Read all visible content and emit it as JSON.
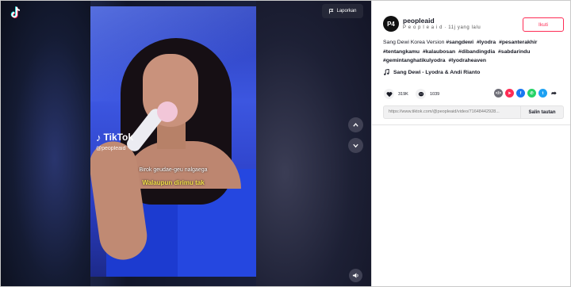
{
  "viewer": {
    "report_label": "Laporkan",
    "watermark": {
      "brand": "TikTok",
      "handle": "@peopleaid"
    },
    "subtitle_line1": "Birok geudae-geu nalgaega",
    "subtitle_line2": "Walaupun dirimu tak"
  },
  "author": {
    "avatar_text": "P4",
    "username": "peopleaid",
    "display_name": "P e o p l e a i d",
    "separator": " · ",
    "time_ago": "11j yang lalu",
    "follow_label": "Ikuti"
  },
  "caption": {
    "text": "Sang Dewi Korea Version",
    "hashtags": [
      "#sangdewi",
      "#lyodra",
      "#pesanterakhir",
      "#tentangkamu",
      "#kalaubosan",
      "#dibandingdia",
      "#sabdarindu",
      "#gemintanghatikulyodra",
      "#lyodraheaven"
    ]
  },
  "music": {
    "title": "Sang Dewi - Lyodra & Andi Rianto"
  },
  "stats": {
    "likes": "319K",
    "comments": "1039"
  },
  "share": {
    "url": "https://www.tiktok.com/@peopleaid/video/71648442928...",
    "copy_label": "Salin tautan"
  },
  "colors": {
    "accent": "#fe2c55",
    "subtitle": "#f6e24a"
  },
  "icons": [
    "tiktok-logo-icon",
    "flag-icon",
    "chevron-up-icon",
    "chevron-down-icon",
    "volume-icon",
    "music-note-icon",
    "heart-icon",
    "comment-icon",
    "embed-icon",
    "send-icon",
    "facebook-icon",
    "whatsapp-icon",
    "twitter-icon",
    "share-arrow-icon"
  ]
}
